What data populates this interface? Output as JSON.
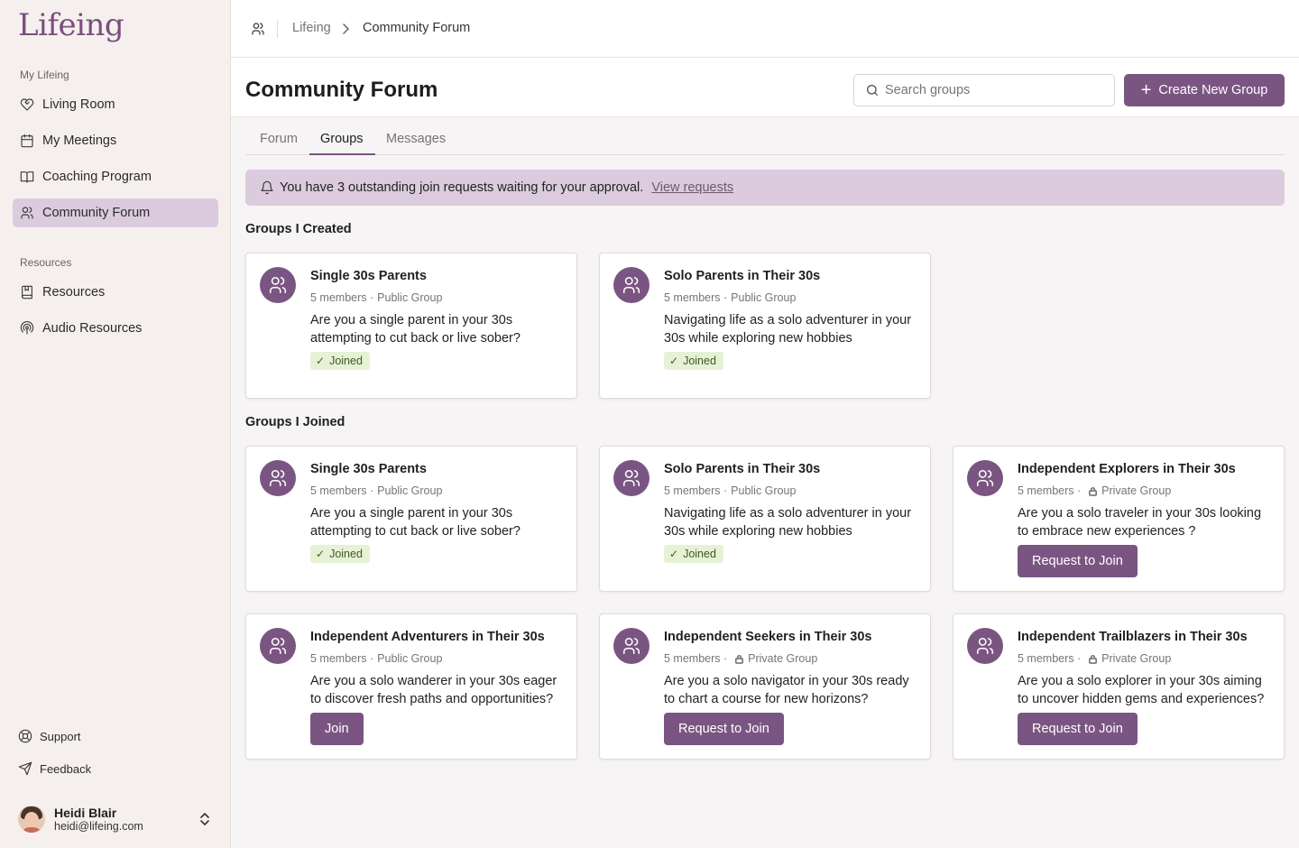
{
  "brand": {
    "name": "Lifeing",
    "accent": "#7b5582"
  },
  "sidebar": {
    "section1_label": "My Lifeing",
    "section1": [
      {
        "label": "Living Room",
        "icon": "heart-hands-icon"
      },
      {
        "label": "My Meetings",
        "icon": "calendar-icon"
      },
      {
        "label": "Coaching Program",
        "icon": "book-open-icon"
      },
      {
        "label": "Community Forum",
        "icon": "users-icon",
        "active": true
      }
    ],
    "section2_label": "Resources",
    "section2": [
      {
        "label": "Resources",
        "icon": "bookmark-book-icon"
      },
      {
        "label": "Audio Resources",
        "icon": "podcast-icon"
      }
    ],
    "bottom": [
      {
        "label": "Support",
        "icon": "lifebuoy-icon"
      },
      {
        "label": "Feedback",
        "icon": "send-icon"
      }
    ],
    "user": {
      "name": "Heidi Blair",
      "email": "heidi@lifeing.com"
    }
  },
  "breadcrumb": {
    "root": "Lifeing",
    "current": "Community Forum"
  },
  "header": {
    "title": "Community Forum",
    "search_placeholder": "Search groups",
    "create_label": "Create New Group"
  },
  "tabs": [
    {
      "label": "Forum"
    },
    {
      "label": "Groups",
      "active": true
    },
    {
      "label": "Messages"
    }
  ],
  "banner": {
    "text": "You have 3 outstanding join requests waiting for your approval.",
    "link": "View requests"
  },
  "created": {
    "heading": "Groups I Created",
    "cards": [
      {
        "title": "Single 30s Parents",
        "members": "5 members",
        "visibility": "Public Group",
        "private": false,
        "desc": "Are you a single parent in your 30s attempting to cut back or live sober?",
        "status": "Joined"
      },
      {
        "title": "Solo Parents in Their 30s",
        "members": "5 members",
        "visibility": "Public Group",
        "private": false,
        "desc": "Navigating life as a solo adventurer in your 30s while exploring new hobbies",
        "status": "Joined"
      }
    ]
  },
  "joined": {
    "heading": "Groups I Joined",
    "cards": [
      {
        "title": "Single 30s Parents",
        "members": "5 members",
        "visibility": "Public Group",
        "private": false,
        "desc": "Are you a single parent in your 30s attempting to cut back or live sober?",
        "status": "Joined"
      },
      {
        "title": "Solo Parents in Their 30s",
        "members": "5 members",
        "visibility": "Public Group",
        "private": false,
        "desc": "Navigating life as a solo adventurer in your 30s while exploring new hobbies",
        "status": "Joined"
      },
      {
        "title": "Independent Explorers in Their 30s",
        "members": "5 members",
        "visibility": "Private Group",
        "private": true,
        "desc": "Are you a solo traveler in your 30s looking to embrace new experiences ?",
        "action": "Request to Join"
      },
      {
        "title": "Independent Adventurers in Their 30s",
        "members": "5 members",
        "visibility": "Public Group",
        "private": false,
        "desc": "Are you a solo wanderer in your 30s eager to discover fresh paths and opportunities?",
        "action": "Join"
      },
      {
        "title": "Independent Seekers in Their 30s",
        "members": "5 members",
        "visibility": "Private Group",
        "private": true,
        "desc": "Are you a solo navigator in your 30s ready to chart a course for new horizons?",
        "action": "Request to Join"
      },
      {
        "title": "Independent Trailblazers in Their 30s",
        "members": "5 members",
        "visibility": "Private Group",
        "private": true,
        "desc": "Are you a solo explorer in your 30s aiming to uncover hidden gems and experiences?",
        "action": "Request to Join"
      }
    ]
  }
}
